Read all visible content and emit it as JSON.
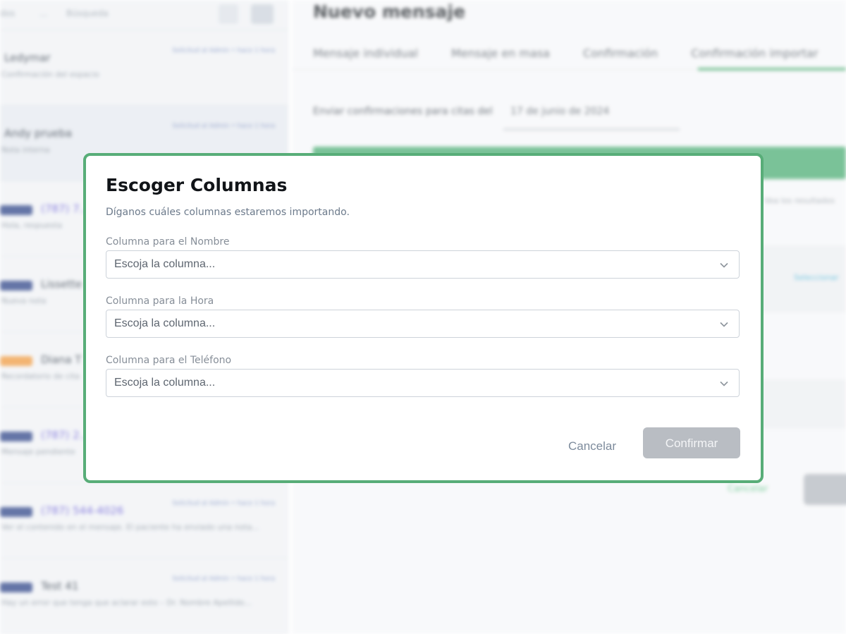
{
  "background": {
    "sidebar": {
      "top": [
        "dos",
        "...",
        "Búsqueda"
      ],
      "conversations": [
        {
          "name": "Ledymar",
          "tag": "",
          "date": "Solicitud al Admin • hace 1 hora",
          "preview": "Confirmación del espacio"
        },
        {
          "name": "Andy prueba",
          "tag": "",
          "date": "Solicitud al Admin • hace 1 hora",
          "preview": "Nota interna"
        },
        {
          "name": "(787) 7..",
          "tag": "blue",
          "date": "",
          "preview": "Hola, respuesta"
        },
        {
          "name": "Lissette",
          "tag": "blue",
          "date": "",
          "preview": "Nueva nota"
        },
        {
          "name": "Diana T",
          "tag": "orange",
          "date": "",
          "preview": "Recordatorio de cita"
        },
        {
          "name": "(787) 2..",
          "tag": "blue",
          "date": "",
          "preview": "Mensaje pendiente"
        },
        {
          "name": "(787) 544-4026",
          "tag": "blue",
          "date": "Solicitud al Admin • hace 1 hora",
          "preview": "Ver el contenido en el mensaje. El paciente ha enviado una nota..."
        },
        {
          "name": "Test 41",
          "tag": "blue",
          "date": "Solicitud al Admin • hace 1 hora",
          "preview": "Hay un error que tenga que aclarar esto – Dr. Nombre Apellido..."
        }
      ]
    },
    "main": {
      "title": "Nuevo mensaje",
      "tabs": [
        "Mensaje individual",
        "Mensaje en masa",
        "Confirmación",
        "Confirmación importar"
      ],
      "send_label": "Enviar confirmaciones para citas del",
      "send_date": "17 de junio de 2024",
      "side_text": "Vea los resultados",
      "link_text": "Seleccionar",
      "cancel": "Cancelar"
    }
  },
  "modal": {
    "title": "Escoger Columnas",
    "subtitle": "Díganos cuáles columnas estaremos importando.",
    "fields": [
      {
        "label": "Columna para el Nombre",
        "value": "Escoja la columna..."
      },
      {
        "label": "Columna para la Hora",
        "value": "Escoja la columna..."
      },
      {
        "label": "Columna para el Teléfono",
        "value": "Escoja la columna..."
      }
    ],
    "cancel_label": "Cancelar",
    "confirm_label": "Confirmar",
    "colors": {
      "border": "#58ad78",
      "confirm_bg": "#b9bdc3"
    }
  }
}
